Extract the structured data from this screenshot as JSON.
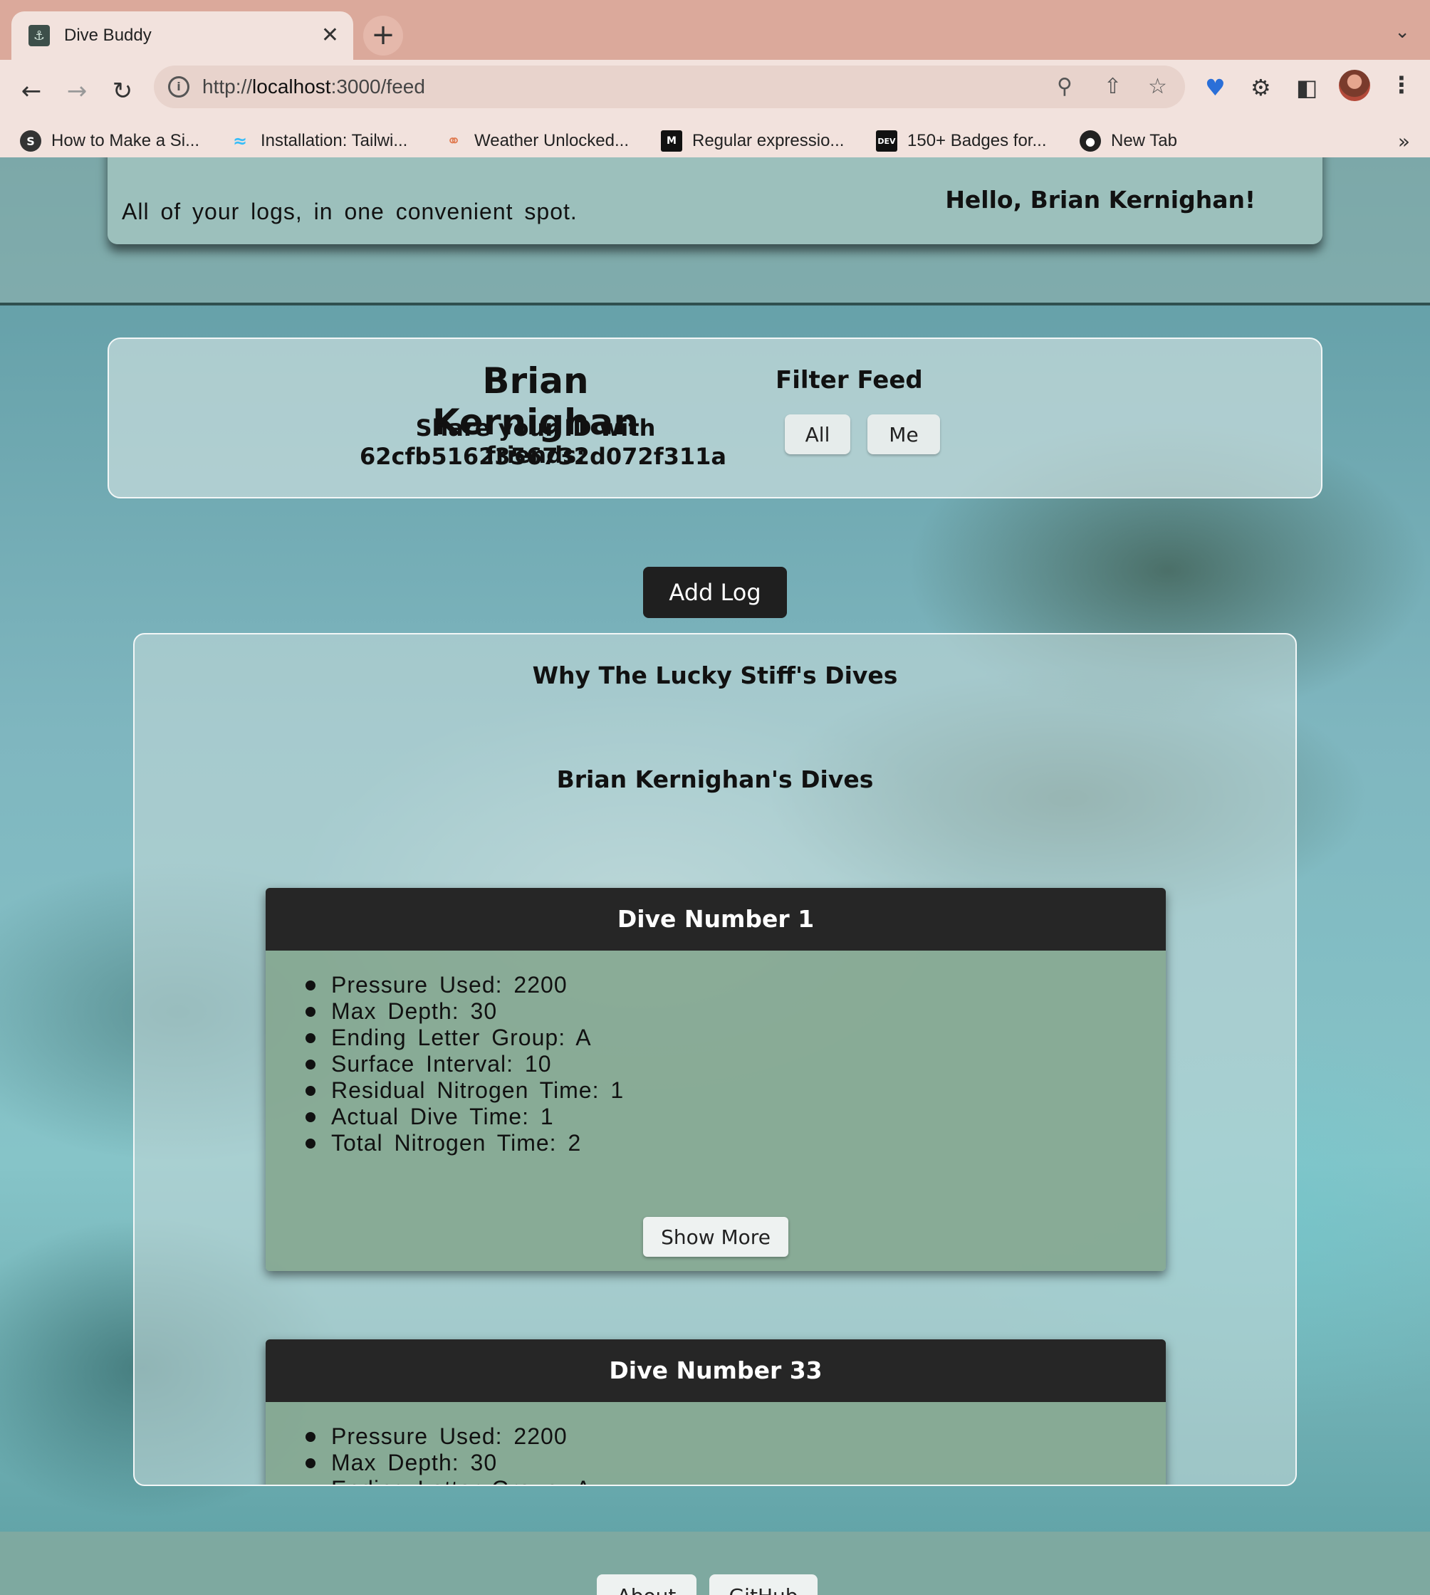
{
  "browser": {
    "tab_title": "Dive Buddy",
    "url_prefix": "http://",
    "url_host": "localhost",
    "url_path": ":3000/feed",
    "bookmarks": [
      {
        "label": "How to Make a Si...",
        "icon": "s-logo-icon",
        "color": "#333333"
      },
      {
        "label": "Installation: Tailwi...",
        "icon": "tailwind-icon",
        "color": "#38bdf8"
      },
      {
        "label": "Weather Unlocked...",
        "icon": "lock-icon",
        "color": "#e07a50"
      },
      {
        "label": "Regular expressio...",
        "icon": "mdn-icon",
        "color": "#111111"
      },
      {
        "label": "150+ Badges for...",
        "icon": "dev-icon",
        "color": "#111111"
      },
      {
        "label": "New Tab",
        "icon": "globe-icon",
        "color": "#222222"
      }
    ]
  },
  "header": {
    "tagline": "All of your logs, in one convenient spot.",
    "greeting": "Hello, Brian Kernighan!"
  },
  "profile": {
    "name": "Brian Kernighan",
    "share_label": "Share your ID with friends:",
    "user_id": "62cfb5162356732d072f311a",
    "filter_title": "Filter Feed",
    "filter_all": "All",
    "filter_me": "Me"
  },
  "add_log_label": "Add Log",
  "feed": {
    "heading_1": "Why The Lucky Stiff's Dives",
    "heading_2": "Brian Kernighan's Dives",
    "dives": [
      {
        "title": "Dive Number 1",
        "stats": [
          "Pressure Used: 2200",
          "Max Depth: 30",
          "Ending Letter Group: A",
          "Surface Interval: 10",
          "Residual Nitrogen Time: 1",
          "Actual Dive Time: 1",
          "Total Nitrogen Time: 2"
        ],
        "show_more": "Show More"
      },
      {
        "title": "Dive Number 33",
        "stats": [
          "Pressure Used: 2200",
          "Max Depth: 30",
          "Ending Letter Group: A"
        ]
      }
    ]
  },
  "footer": {
    "about": "About",
    "github": "GitHub"
  }
}
